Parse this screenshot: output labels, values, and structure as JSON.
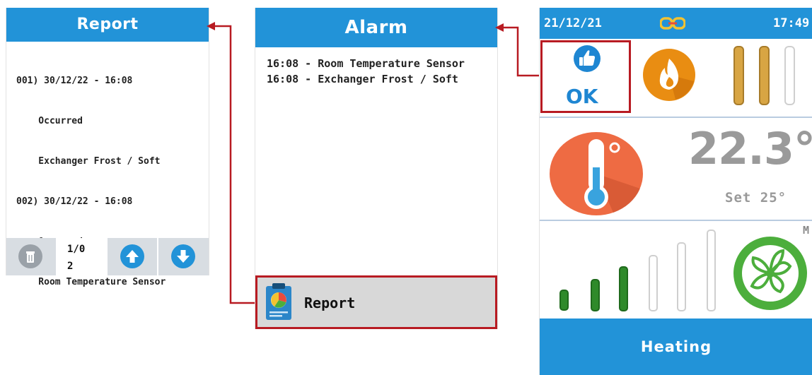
{
  "report_panel": {
    "title": "Report",
    "entries": [
      "001) 30/12/22 - 16:08",
      "    Occurred",
      "    Exchanger Frost / Soft",
      "002) 30/12/22 - 16:08",
      "    Occurred",
      "    Room Temperature Sensor"
    ],
    "page_counter_line1": "1/0",
    "page_counter_line2": "2",
    "icons": [
      "trash-icon",
      "arrow-up-icon",
      "arrow-down-icon"
    ]
  },
  "alarm_panel": {
    "title": "Alarm",
    "entries": [
      "16:08 - Room Temperature Sensor",
      "16:08 - Exchanger Frost / Soft"
    ],
    "report_button_label": "Report",
    "report_icon": "clipboard-chart-icon"
  },
  "main_panel": {
    "date": "21/12/21",
    "time": "17:49",
    "link_icon": "chain-link-icon",
    "status_label": "OK",
    "status_icon": "thumbs-up-icon",
    "flame_icon": "flame-icon",
    "burner_level": "2 of 3",
    "temperature": "22.3°",
    "setpoint": "Set 25°",
    "thermometer_icon": "thermometer-icon",
    "fan_icon": "fan-icon",
    "fan_mode": "M",
    "fan_level": "3 of 7",
    "mode_label": "Heating"
  },
  "colors": {
    "header_blue": "#2293d8",
    "highlight_red": "#b81b22",
    "flame_orange": "#e98d12",
    "thermo_red": "#ee6b43",
    "fan_green": "#4cae3c",
    "bar_green": "#2f8a2a"
  }
}
